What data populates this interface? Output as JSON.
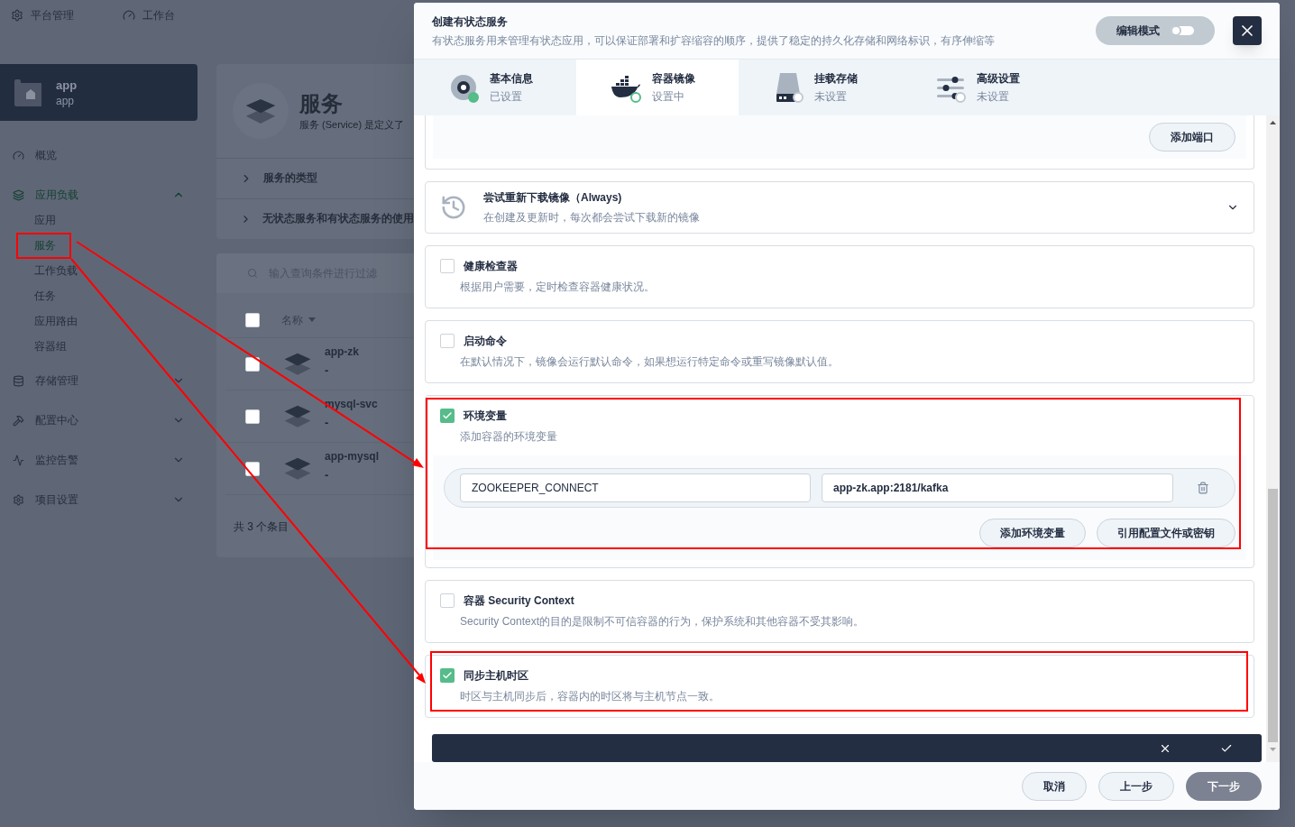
{
  "top_nav": [
    {
      "label": "平台管理"
    },
    {
      "label": "工作台"
    }
  ],
  "project": {
    "name": "app",
    "subtitle": "app"
  },
  "sidebar": {
    "items": [
      {
        "label": "概览",
        "selected": false
      },
      {
        "label": "应用负载",
        "selected": true,
        "expanded": true,
        "children": [
          {
            "label": "应用",
            "selected": false
          },
          {
            "label": "服务",
            "selected": true
          },
          {
            "label": "工作负载",
            "selected": false
          },
          {
            "label": "任务",
            "selected": false
          },
          {
            "label": "应用路由",
            "selected": false
          },
          {
            "label": "容器组",
            "selected": false
          }
        ]
      },
      {
        "label": "存储管理",
        "selected": false,
        "expanded": false
      },
      {
        "label": "配置中心",
        "selected": false,
        "expanded": false
      },
      {
        "label": "监控告警",
        "selected": false,
        "expanded": false
      },
      {
        "label": "项目设置",
        "selected": false,
        "expanded": false
      }
    ]
  },
  "service_panel": {
    "title": "服务",
    "description": "服务 (Service) 是定义了",
    "sections": [
      {
        "label": "服务的类型",
        "expanded": false
      },
      {
        "label": "无状态服务和有状态服务的使用",
        "expanded": false
      }
    ],
    "search": {
      "placeholder": "输入查询条件进行过滤"
    },
    "table": {
      "select_all": {
        "checked": false
      },
      "columns": [
        "名称"
      ],
      "rows": [
        {
          "name": "app-zk",
          "detail": "-",
          "selected": false
        },
        {
          "name": "mysql-svc",
          "detail": "-",
          "selected": false
        },
        {
          "name": "app-mysql",
          "detail": "-",
          "selected": false
        }
      ]
    },
    "footer": "共 3 个条目"
  },
  "modal": {
    "title": "创建有状态服务",
    "description": "有状态服务用来管理有状态应用，可以保证部署和扩容缩容的顺序，提供了稳定的持久化存储和网络标识，有序伸缩等",
    "edit_mode": {
      "label": "编辑模式",
      "on": false
    },
    "steps": [
      {
        "title": "基本信息",
        "status_text": "已设置",
        "completed": true,
        "selected": false
      },
      {
        "title": "容器镜像",
        "status_text": "设置中",
        "completed": false,
        "selected": true
      },
      {
        "title": "挂载存储",
        "status_text": "未设置",
        "completed": false,
        "selected": false
      },
      {
        "title": "高级设置",
        "status_text": "未设置",
        "completed": false,
        "selected": false
      }
    ],
    "ports_button": "添加端口",
    "pull_policy": {
      "title": "尝试重新下载镜像（Always)",
      "description": "在创建及更新时，每次都会尝试下载新的镜像",
      "expanded": false
    },
    "options": [
      {
        "kind": "plain",
        "title": "健康检查器",
        "description": "根据用户需要，定时检查容器健康状况。",
        "checked": false
      },
      {
        "kind": "plain",
        "title": "启动命令",
        "description": "在默认情况下，镜像会运行默认命令，如果想运行特定命令或重写镜像默认值。",
        "checked": false
      },
      {
        "kind": "env",
        "title": "环境变量",
        "description": "添加容器的环境变量",
        "checked": true
      },
      {
        "kind": "plain",
        "title": "容器 Security Context",
        "description": "Security Context的目的是限制不可信容器的行为，保护系统和其他容器不受其影响。",
        "checked": false
      },
      {
        "kind": "plain",
        "title": "同步主机时区",
        "description": "时区与主机同步后，容器内的时区将与主机节点一致。",
        "checked": true
      }
    ],
    "env": {
      "variables": [
        {
          "name": "ZOOKEEPER_CONNECT",
          "value": "app-zk.app:2181/kafka"
        }
      ],
      "buttons": [
        "添加环境变量",
        "引用配置文件或密钥"
      ]
    },
    "footer_buttons": [
      {
        "label": "取消",
        "kind": "secondary"
      },
      {
        "label": "上一步",
        "kind": "secondary"
      },
      {
        "label": "下一步",
        "kind": "primary"
      }
    ]
  }
}
